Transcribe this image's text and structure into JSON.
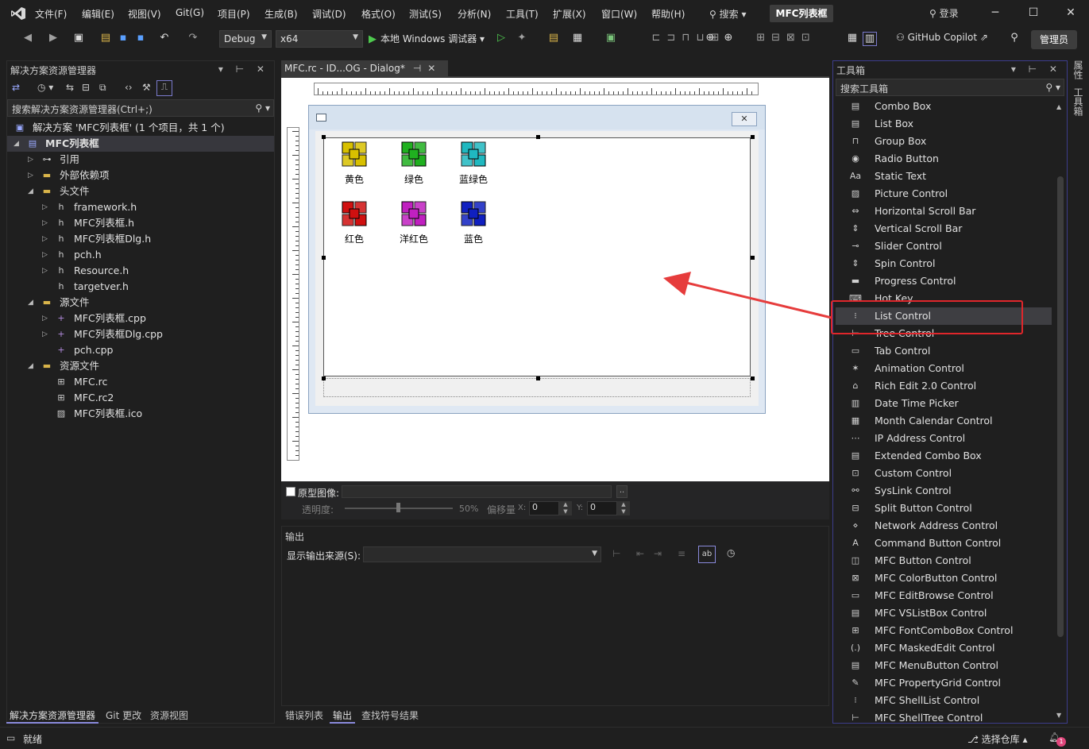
{
  "menu": [
    "文件(F)",
    "编辑(E)",
    "视图(V)",
    "Git(G)",
    "项目(P)",
    "生成(B)",
    "调试(D)",
    "格式(O)",
    "测试(S)",
    "分析(N)",
    "工具(T)",
    "扩展(X)",
    "窗口(W)",
    "帮助(H)"
  ],
  "search_label": "搜索",
  "title": "MFC列表框",
  "login": "登录",
  "toolbar": {
    "config": "Debug",
    "platform": "x64",
    "run_label": "本地 Windows 调试器",
    "copilot": "GitHub Copilot",
    "admin": "管理员"
  },
  "solution_explorer": {
    "title": "解决方案资源管理器",
    "search_placeholder": "搜索解决方案资源管理器(Ctrl+;)",
    "items": [
      {
        "label": "解决方案 'MFC列表框' (1 个项目，共 1 个)"
      },
      {
        "label": "MFC列表框"
      },
      {
        "label": "引用"
      },
      {
        "label": "外部依赖项"
      },
      {
        "label": "头文件"
      },
      {
        "label": "framework.h"
      },
      {
        "label": "MFC列表框.h"
      },
      {
        "label": "MFC列表框Dlg.h"
      },
      {
        "label": "pch.h"
      },
      {
        "label": "Resource.h"
      },
      {
        "label": "targetver.h"
      },
      {
        "label": "源文件"
      },
      {
        "label": "MFC列表框.cpp"
      },
      {
        "label": "MFC列表框Dlg.cpp"
      },
      {
        "label": "pch.cpp"
      },
      {
        "label": "资源文件"
      },
      {
        "label": "MFC.rc"
      },
      {
        "label": "MFC.rc2"
      },
      {
        "label": "MFC列表框.ico"
      }
    ],
    "tabs": [
      "解决方案资源管理器",
      "Git 更改",
      "资源视图"
    ]
  },
  "editor": {
    "tab": "MFC.rc - ID...OG - Dialog*",
    "list_items": [
      {
        "label": "黄色",
        "color": "#d8c000"
      },
      {
        "label": "绿色",
        "color": "#20b020"
      },
      {
        "label": "蓝绿色",
        "color": "#20b8c0"
      },
      {
        "label": "红色",
        "color": "#d01010"
      },
      {
        "label": "洋红色",
        "color": "#c020c0"
      },
      {
        "label": "蓝色",
        "color": "#1020c0"
      }
    ],
    "proto_label": "原型图像:",
    "opacity_label": "透明度:",
    "opacity_value": "50%",
    "offset_label": "偏移量",
    "x_label": "X:",
    "y_label": "Y:",
    "x_value": "0",
    "y_value": "0"
  },
  "output": {
    "title": "输出",
    "source_label": "显示输出来源(S):",
    "tabs": [
      "错误列表",
      "输出",
      "查找符号结果"
    ]
  },
  "toolbox": {
    "title": "工具箱",
    "search_placeholder": "搜索工具箱",
    "items": [
      "Combo Box",
      "List Box",
      "Group Box",
      "Radio Button",
      "Static Text",
      "Picture Control",
      "Horizontal Scroll Bar",
      "Vertical Scroll Bar",
      "Slider Control",
      "Spin Control",
      "Progress Control",
      "Hot Key",
      "List Control",
      "Tree Control",
      "Tab Control",
      "Animation Control",
      "Rich Edit 2.0 Control",
      "Date Time Picker",
      "Month Calendar Control",
      "IP Address Control",
      "Extended Combo Box",
      "Custom Control",
      "SysLink Control",
      "Split Button Control",
      "Network Address Control",
      "Command Button Control",
      "MFC Button Control",
      "MFC ColorButton Control",
      "MFC EditBrowse Control",
      "MFC VSListBox Control",
      "MFC FontComboBox Control",
      "MFC MaskedEdit Control",
      "MFC MenuButton Control",
      "MFC PropertyGrid Control",
      "MFC ShellList Control",
      "MFC ShellTree Control"
    ],
    "selected": "List Control"
  },
  "side_tabs": [
    "属性",
    "工具箱"
  ],
  "status": {
    "ready": "就绪",
    "repo": "选择仓库",
    "notif": "1"
  },
  "colors": {
    "accent": "#3c3c8c",
    "highlight": "#e0262b",
    "selection": "#3e3e42"
  }
}
